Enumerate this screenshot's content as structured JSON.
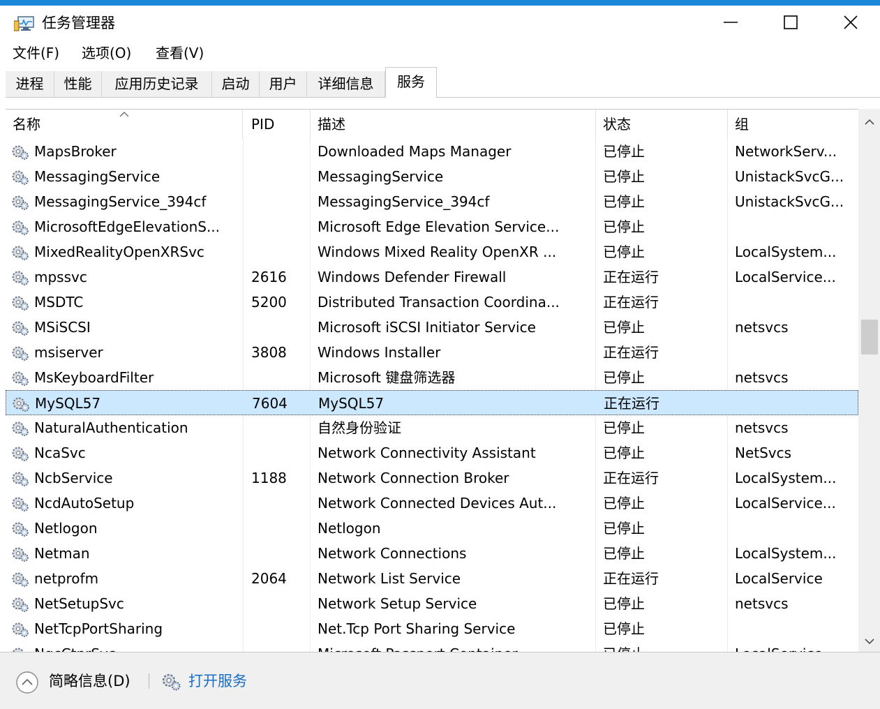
{
  "window": {
    "title": "任务管理器"
  },
  "menu": [
    {
      "label": "文件(F)"
    },
    {
      "label": "选项(O)"
    },
    {
      "label": "查看(V)"
    }
  ],
  "tabs": [
    {
      "label": "进程"
    },
    {
      "label": "性能"
    },
    {
      "label": "应用历史记录"
    },
    {
      "label": "启动"
    },
    {
      "label": "用户"
    },
    {
      "label": "详细信息"
    },
    {
      "label": "服务",
      "active": true
    }
  ],
  "columns": {
    "name": "名称",
    "pid": "PID",
    "desc": "描述",
    "status": "状态",
    "group": "组"
  },
  "rows": [
    {
      "name": "MapsBroker",
      "pid": "",
      "desc": "Downloaded Maps Manager",
      "status": "已停止",
      "group": "NetworkServ..."
    },
    {
      "name": "MessagingService",
      "pid": "",
      "desc": "MessagingService",
      "status": "已停止",
      "group": "UnistackSvcG..."
    },
    {
      "name": "MessagingService_394cf",
      "pid": "",
      "desc": "MessagingService_394cf",
      "status": "已停止",
      "group": "UnistackSvcG..."
    },
    {
      "name": "MicrosoftEdgeElevationS...",
      "pid": "",
      "desc": "Microsoft Edge Elevation Service...",
      "status": "已停止",
      "group": ""
    },
    {
      "name": "MixedRealityOpenXRSvc",
      "pid": "",
      "desc": "Windows Mixed Reality OpenXR ...",
      "status": "已停止",
      "group": "LocalSystem..."
    },
    {
      "name": "mpssvc",
      "pid": "2616",
      "desc": "Windows Defender Firewall",
      "status": "正在运行",
      "group": "LocalService..."
    },
    {
      "name": "MSDTC",
      "pid": "5200",
      "desc": "Distributed Transaction Coordina...",
      "status": "正在运行",
      "group": ""
    },
    {
      "name": "MSiSCSI",
      "pid": "",
      "desc": "Microsoft iSCSI Initiator Service",
      "status": "已停止",
      "group": "netsvcs"
    },
    {
      "name": "msiserver",
      "pid": "3808",
      "desc": "Windows Installer",
      "status": "正在运行",
      "group": ""
    },
    {
      "name": "MsKeyboardFilter",
      "pid": "",
      "desc": "Microsoft 键盘筛选器",
      "status": "已停止",
      "group": "netsvcs"
    },
    {
      "name": "MySQL57",
      "pid": "7604",
      "desc": "MySQL57",
      "status": "正在运行",
      "group": "",
      "selected": true
    },
    {
      "name": "NaturalAuthentication",
      "pid": "",
      "desc": "自然身份验证",
      "status": "已停止",
      "group": "netsvcs"
    },
    {
      "name": "NcaSvc",
      "pid": "",
      "desc": "Network Connectivity Assistant",
      "status": "已停止",
      "group": "NetSvcs"
    },
    {
      "name": "NcbService",
      "pid": "1188",
      "desc": "Network Connection Broker",
      "status": "正在运行",
      "group": "LocalSystem..."
    },
    {
      "name": "NcdAutoSetup",
      "pid": "",
      "desc": "Network Connected Devices Aut...",
      "status": "已停止",
      "group": "LocalService..."
    },
    {
      "name": "Netlogon",
      "pid": "",
      "desc": "Netlogon",
      "status": "已停止",
      "group": ""
    },
    {
      "name": "Netman",
      "pid": "",
      "desc": "Network Connections",
      "status": "已停止",
      "group": "LocalSystem..."
    },
    {
      "name": "netprofm",
      "pid": "2064",
      "desc": "Network List Service",
      "status": "正在运行",
      "group": "LocalService"
    },
    {
      "name": "NetSetupSvc",
      "pid": "",
      "desc": "Network Setup Service",
      "status": "已停止",
      "group": "netsvcs"
    },
    {
      "name": "NetTcpPortSharing",
      "pid": "",
      "desc": "Net.Tcp Port Sharing Service",
      "status": "已停止",
      "group": ""
    },
    {
      "name": "NgcCtnrSvc",
      "pid": "",
      "desc": "Microsoft Passport Container",
      "status": "已停止",
      "group": "LocalService..."
    }
  ],
  "footer": {
    "fewer_details": "简略信息(D)",
    "open_services": "打开服务"
  },
  "colors": {
    "accent": "#1a87d9",
    "selection": "#cce8ff",
    "link": "#1a6fc4"
  }
}
